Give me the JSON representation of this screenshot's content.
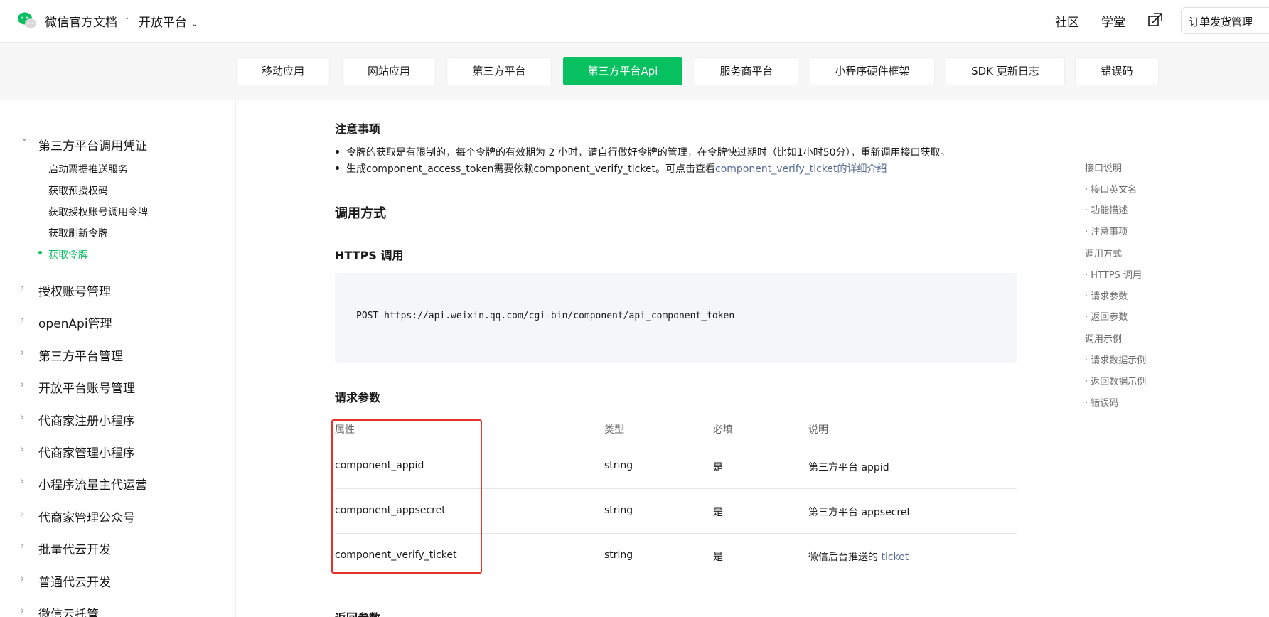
{
  "header": {
    "brand": "微信官方文档",
    "separator": "·",
    "platform_label": "开放平台",
    "nav_community": "社区",
    "nav_learn": "学堂",
    "order_button": "订单发货管理"
  },
  "tabs": [
    {
      "label": "移动应用"
    },
    {
      "label": "网站应用"
    },
    {
      "label": "第三方平台"
    },
    {
      "label": "第三方平台Api",
      "active": true
    },
    {
      "label": "服务商平台"
    },
    {
      "label": "小程序硬件框架"
    },
    {
      "label": "SDK 更新日志"
    },
    {
      "label": "错误码"
    }
  ],
  "sidebar": {
    "expanded_group": "第三方平台调用凭证",
    "sub_items": [
      "启动票据推送服务",
      "获取预授权码",
      "获取授权账号调用令牌",
      "获取刷新令牌",
      "获取令牌"
    ],
    "groups": [
      "授权账号管理",
      "openApi管理",
      "第三方平台管理",
      "开放平台账号管理",
      "代商家注册小程序",
      "代商家管理小程序",
      "小程序流量主代运营",
      "代商家管理公众号",
      "批量代云开发",
      "普通代云开发",
      "微信云托管"
    ]
  },
  "content": {
    "notes_title": "注意事项",
    "note1": "令牌的获取是有限制的，每个令牌的有效期为 2 小时，请自行做好令牌的管理，在令牌快过期时（比如1小时50分），重新调用接口获取。",
    "note2_text": "生成component_access_token需要依赖component_verify_ticket。可点击查看",
    "note2_link": "component_verify_ticket的详细介绍",
    "call_title": "调用方式",
    "https_title": "HTTPS 调用",
    "code": "POST https://api.weixin.qq.com/cgi-bin/component/api_component_token",
    "params_title": "请求参数",
    "table": {
      "headers": [
        "属性",
        "类型",
        "必填",
        "说明"
      ],
      "rows": [
        {
          "name": "component_appid",
          "type": "string",
          "required": "是",
          "desc": "第三方平台 appid",
          "link": ""
        },
        {
          "name": "component_appsecret",
          "type": "string",
          "required": "是",
          "desc": "第三方平台 appsecret",
          "link": ""
        },
        {
          "name": "component_verify_ticket",
          "type": "string",
          "required": "是",
          "desc": "微信后台推送的 ",
          "link": "ticket"
        }
      ]
    },
    "return_title": "返回参数"
  },
  "toc": [
    "接口说明",
    "· 接口英文名",
    "· 功能描述",
    "· 注意事项",
    "调用方式",
    "· HTTPS 调用",
    "· 请求参数",
    "· 返回参数",
    "调用示例",
    "· 请求数据示例",
    "· 返回数据示例",
    "· 错误码"
  ],
  "colors": {
    "accent": "#07c160",
    "link": "#576b95",
    "highlight_box": "#e5322d"
  },
  "icons": {
    "logo": "wechat-logo-icon",
    "platform_dropdown": "chevron-down-icon",
    "external": "external-link-icon",
    "sidebar_expanded": "chevron-down-icon",
    "sidebar_collapsed": "chevron-right-icon"
  }
}
